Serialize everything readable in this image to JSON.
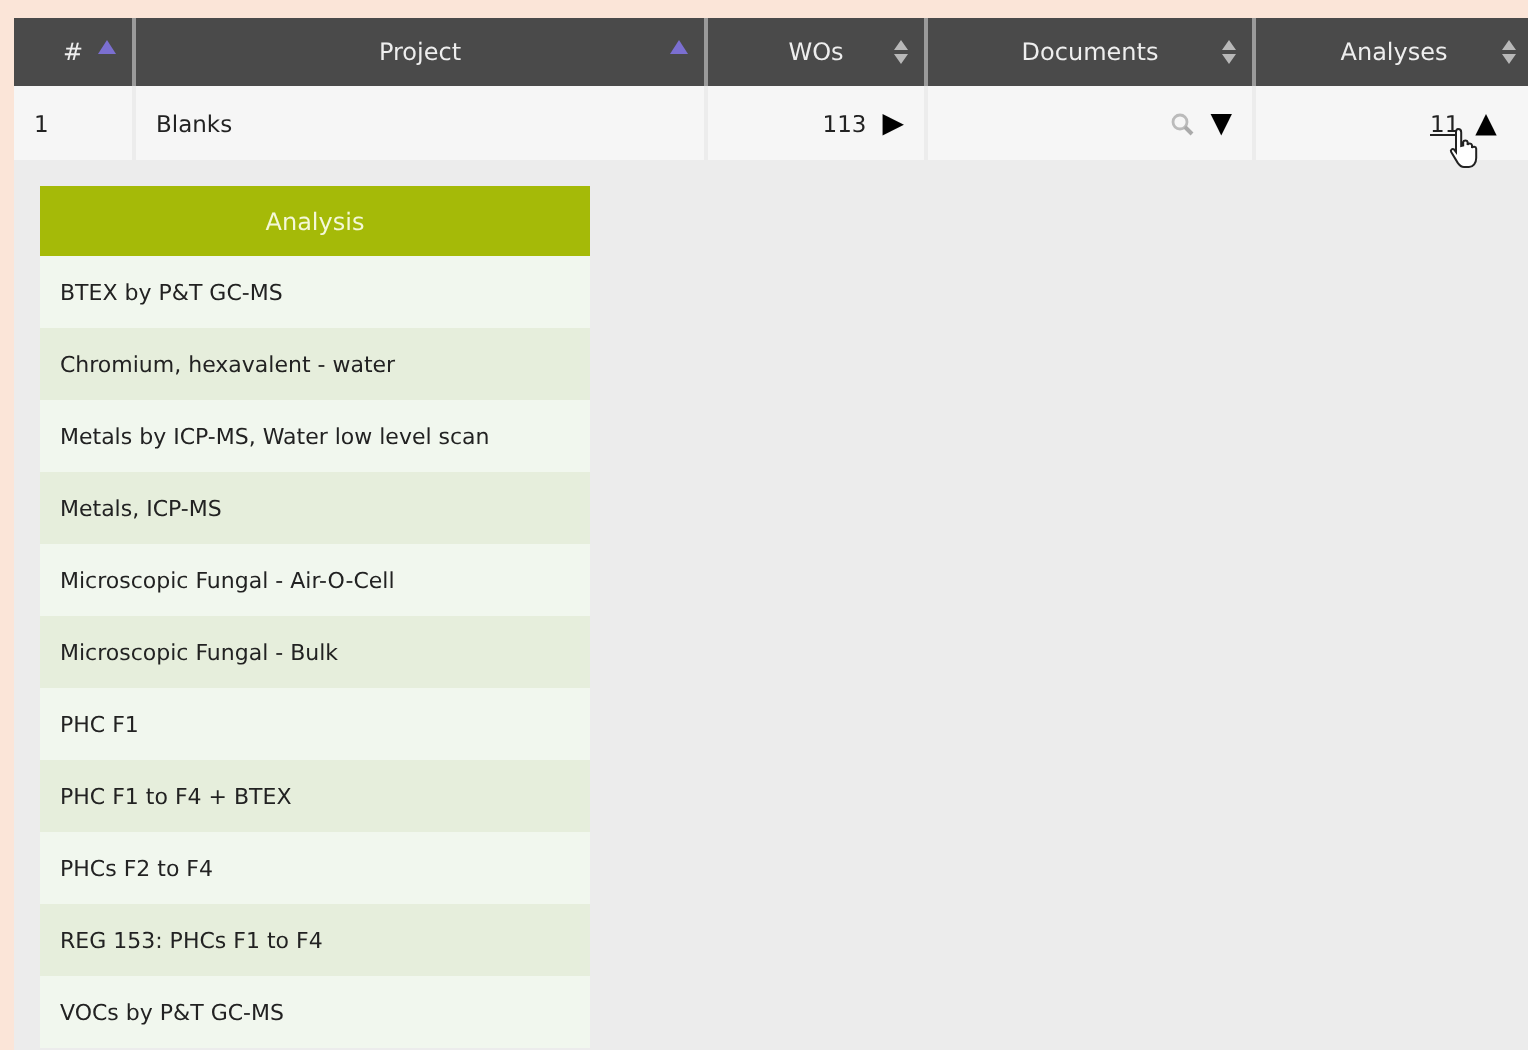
{
  "table": {
    "columns": [
      {
        "label": "#",
        "sorted": true
      },
      {
        "label": "Project",
        "sorted": true
      },
      {
        "label": "WOs",
        "sorted": false
      },
      {
        "label": "Documents",
        "sorted": false
      },
      {
        "label": "Analyses",
        "sorted": false
      }
    ],
    "rows": [
      {
        "number": "1",
        "project": "Blanks",
        "wos": "113",
        "wos_toggle": "▶",
        "documents_toggle": "▼",
        "analyses": "11",
        "analyses_toggle": "▲"
      }
    ]
  },
  "analysis_table": {
    "header": "Analysis",
    "rows": [
      "BTEX by P&T GC-MS",
      "Chromium, hexavalent - water",
      "Metals by ICP-MS, Water low level scan",
      "Metals, ICP-MS",
      "Microscopic Fungal - Air-O-Cell",
      "Microscopic Fungal - Bulk",
      "PHC F1",
      "PHC F1 to F4 + BTEX",
      "PHCs F2 to F4",
      "REG 153: PHCs F1 to F4",
      "VOCs by P&T GC-MS"
    ]
  }
}
